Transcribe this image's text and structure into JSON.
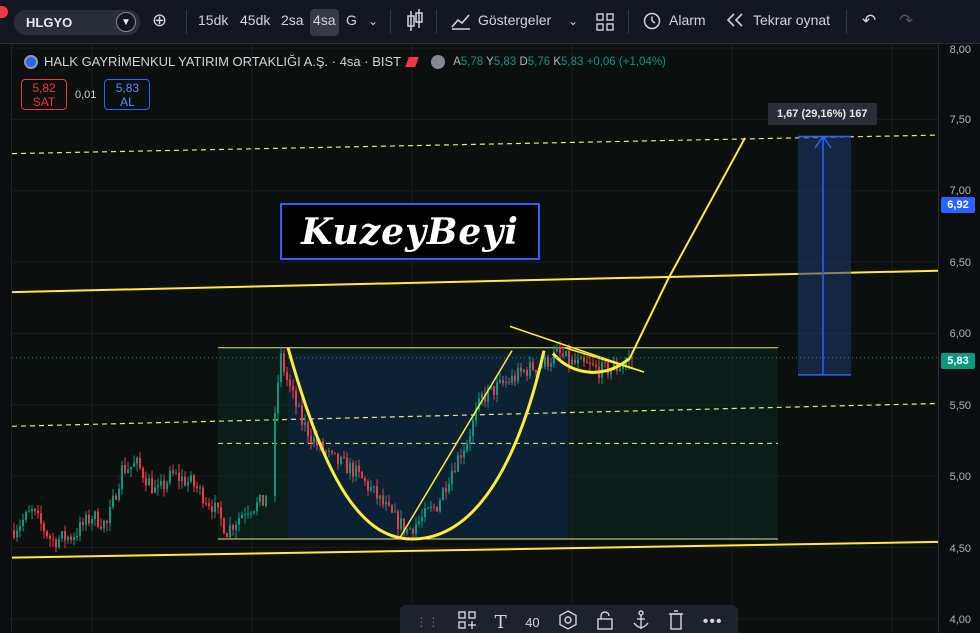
{
  "toolbar": {
    "symbol": "HLGYO",
    "intervals": [
      "15dk",
      "45dk",
      "2sa",
      "4sa",
      "G"
    ],
    "active_interval": "4sa",
    "indicators_label": "Göstergeler",
    "alarm_label": "Alarm",
    "replay_label": "Tekrar oynat"
  },
  "legend": {
    "title": "HALK GAYRİMENKUL YATIRIM ORTAKLIĞI A.Ş. · 4sa · BIST",
    "ohlc": {
      "A": "5,78",
      "Y": "5,83",
      "D": "5,76",
      "K": "5,83",
      "change": "+0,06 (+1,04%)"
    }
  },
  "trade": {
    "sell_price": "5,82",
    "sell_label": "SAT",
    "spread": "0,01",
    "buy_price": "5,83",
    "buy_label": "AL"
  },
  "watermark": "KuzeyBeyi",
  "measure": "1,67 (29,16%) 167",
  "price_axis": {
    "ticks": [
      "8,00",
      "7,50",
      "7,00",
      "6,50",
      "6,00",
      "5,50",
      "5,00",
      "4,50",
      "4,00"
    ],
    "badge_target": "6,92",
    "badge_current": "5,83",
    "colors": {
      "target": "#2962ff",
      "current": "#089981"
    }
  },
  "drawing_toolbar": {
    "width_value": "40",
    "icons": [
      "drag-handle-icon",
      "shapes-icon",
      "text-icon",
      "settings-icon",
      "lock-icon",
      "anchor-icon",
      "trash-icon",
      "more-icon"
    ]
  },
  "colors": {
    "up": "#089981",
    "down": "#f23645",
    "annotation": "#ffeb3b"
  }
}
